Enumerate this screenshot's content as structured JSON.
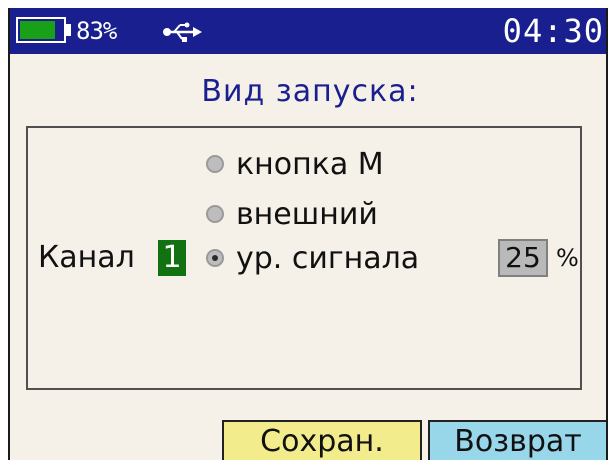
{
  "status_bar": {
    "battery_percent_text": "83%",
    "battery_level": 0.83,
    "usb_icon": "usb-icon",
    "clock": "04:30"
  },
  "title": "Вид запуска:",
  "trigger_options": [
    {
      "label": "кнопка М",
      "selected": false
    },
    {
      "label": "внешний",
      "selected": false
    },
    {
      "label": "ур. сигнала",
      "selected": true
    }
  ],
  "channel": {
    "label": "Канал",
    "value": "1"
  },
  "signal_level": {
    "value": "25",
    "unit": "%"
  },
  "buttons": {
    "save": "Сохран.",
    "back": "Возврат"
  },
  "colors": {
    "status_bar_bg": "#1a1f8f",
    "title_color": "#1a1f8f",
    "battery_fill": "#18a018",
    "channel_bg": "#127212",
    "save_button_bg": "#f2ec8c",
    "back_button_bg": "#98d6ea",
    "screen_bg": "#f5f1e9"
  }
}
